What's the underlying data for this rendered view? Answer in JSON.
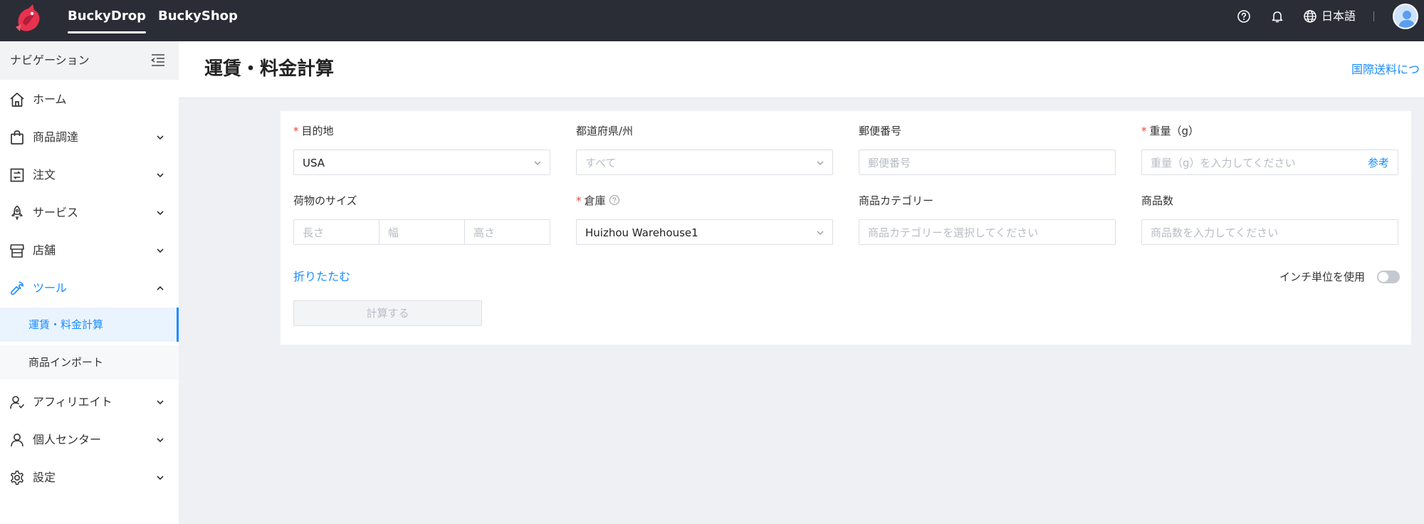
{
  "topbar": {
    "nav": [
      "BuckyDrop",
      "BuckyShop"
    ],
    "active_nav": "BuckyDrop",
    "language": "日本語",
    "icons": [
      "help-icon",
      "bell-icon",
      "globe-icon",
      "avatar"
    ]
  },
  "sidebar": {
    "title": "ナビゲーション",
    "items": [
      {
        "label": "ホーム",
        "icon": "home-icon",
        "has_arrow": false
      },
      {
        "label": "商品調達",
        "icon": "bag-icon",
        "has_arrow": true
      },
      {
        "label": "注文",
        "icon": "order-icon",
        "has_arrow": true
      },
      {
        "label": "サービス",
        "icon": "rocket-icon",
        "has_arrow": true
      },
      {
        "label": "店舗",
        "icon": "store-icon",
        "has_arrow": true
      },
      {
        "label": "ツール",
        "icon": "wrench-icon",
        "has_arrow": true,
        "expanded": true
      },
      {
        "label": "アフィリエイト",
        "icon": "affiliate-icon",
        "has_arrow": true
      },
      {
        "label": "個人センター",
        "icon": "user-icon",
        "has_arrow": true
      },
      {
        "label": "設定",
        "icon": "gear-icon",
        "has_arrow": true
      }
    ],
    "tool_sub": [
      {
        "label": "運賃・料金計算",
        "active": true
      },
      {
        "label": "商品インポート",
        "active": false
      }
    ]
  },
  "page": {
    "title": "運賃・料金計算",
    "link": "国際送料につ"
  },
  "form": {
    "destination": {
      "label": "目的地",
      "required": true,
      "value": "USA"
    },
    "prefecture": {
      "label": "都道府県/州",
      "placeholder": "すべて"
    },
    "postal": {
      "label": "郵便番号",
      "placeholder": "郵便番号"
    },
    "weight": {
      "label": "重量（g）",
      "required": true,
      "placeholder": "重量（g）を入力してください",
      "suffix": "参考"
    },
    "size": {
      "label": "荷物のサイズ",
      "length": "長さ",
      "width": "幅",
      "height": "高さ"
    },
    "warehouse": {
      "label": "倉庫",
      "required": true,
      "value": "Huizhou Warehouse1"
    },
    "category": {
      "label": "商品カテゴリー",
      "placeholder": "商品カテゴリーを選択してください"
    },
    "quantity": {
      "label": "商品数",
      "placeholder": "商品数を入力してください"
    },
    "fold_link": "折りたたむ",
    "unit_toggle_label": "インチ単位を使用",
    "unit_toggle_on": false,
    "calculate_button": "計算する"
  },
  "colors": {
    "accent": "#1a8cff",
    "topbar": "#2a2d36",
    "required": "#f04134"
  }
}
